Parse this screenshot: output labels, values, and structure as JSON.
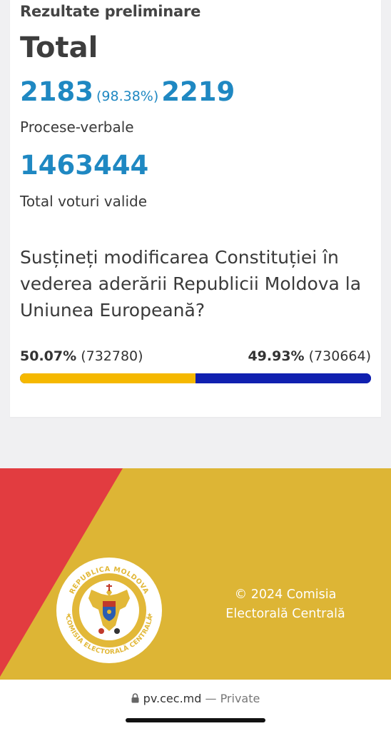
{
  "results": {
    "subtitle": "Rezultate preliminare",
    "title": "Total",
    "reports_counted": "2183",
    "reports_percent": "(98.38%)",
    "reports_total": "2219",
    "reports_label": "Procese-verbale",
    "valid_votes": "1463444",
    "valid_votes_label": "Total voturi valide",
    "question": "Susțineți modificarea Constituției în vederea aderării Republicii Moldova la Uniunea Europeană?",
    "yes": {
      "percent_text": "50.07%",
      "votes_text": "(732780)",
      "share": 50.07,
      "color": "#f5b800"
    },
    "no": {
      "percent_text": "49.93%",
      "votes_text": "(730664)",
      "share": 49.93,
      "color": "#1020b0"
    }
  },
  "footer": {
    "copyright_line1": "© 2024 Comisia",
    "copyright_line2": "Electorală Centrală",
    "seal_top_text": "REPUBLICA MOLDOVA",
    "seal_bottom_text": "COMISIA ELECTORALĂ CENTRALĂ",
    "colors": {
      "red": "#e23c40",
      "yellow": "#ddb535"
    }
  },
  "browser": {
    "url": "pv.cec.md",
    "separator": " — ",
    "mode": "Private"
  }
}
